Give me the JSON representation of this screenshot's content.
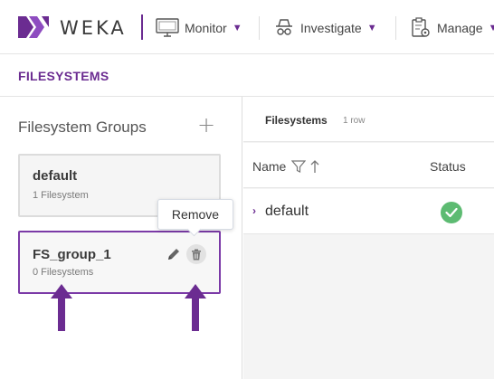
{
  "brand": {
    "name": "WEKA",
    "accent": "#6b2c91"
  },
  "nav": {
    "items": [
      {
        "label": "Monitor",
        "icon": "monitor-icon"
      },
      {
        "label": "Investigate",
        "icon": "detective-icon"
      },
      {
        "label": "Manage",
        "icon": "clipboard-gear-icon"
      }
    ]
  },
  "page": {
    "title": "FILESYSTEMS"
  },
  "groups": {
    "title": "Filesystem Groups",
    "add_symbol": "+",
    "items": [
      {
        "name": "default",
        "count": "1 Filesystem"
      },
      {
        "name": "FS_group_1",
        "count": "0 Filesystems"
      }
    ],
    "tooltip": "Remove"
  },
  "filesystems": {
    "title": "Filesystems",
    "count": "1 row",
    "columns": {
      "name": "Name",
      "status": "Status"
    },
    "rows": [
      {
        "name": "default",
        "status": "ok",
        "status_color": "#5dbb72"
      }
    ]
  },
  "annotation_color": "#6b2c91"
}
